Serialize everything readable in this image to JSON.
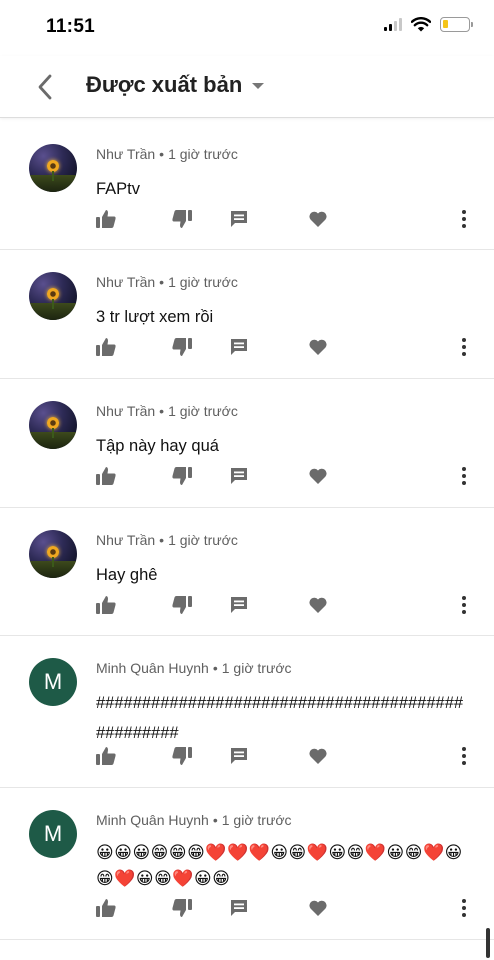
{
  "status_bar": {
    "time": "11:51"
  },
  "header": {
    "title": "Được xuất bản"
  },
  "comments": [
    {
      "avatar": "sunflower-photo",
      "author": "Như Trần",
      "time": "1 giờ trước",
      "text": "FAPtv"
    },
    {
      "avatar": "sunflower-photo",
      "author": "Như Trần",
      "time": "1 giờ trước",
      "text": "3 tr lượt xem rồi"
    },
    {
      "avatar": "sunflower-photo",
      "author": "Như Trần",
      "time": "1 giờ trước",
      "text": "Tập này hay quá"
    },
    {
      "avatar": "sunflower-photo",
      "author": "Như Trần",
      "time": "1 giờ trước",
      "text": "Hay ghê"
    },
    {
      "avatar_letter": "M",
      "author": "Minh Quân Huynh",
      "time": "1 giờ trước",
      "text": "#################################################"
    },
    {
      "avatar_letter": "M",
      "author": "Minh Quân Huynh",
      "time": "1 giờ trước",
      "text": "😀😀😀😁😁😁❤️❤️❤️😀😁❤️😀😁❤️😀😁❤️😀😁❤️😀😁❤️😀😁"
    }
  ],
  "icons": {
    "like": "thumbs-up-icon",
    "dislike": "thumbs-down-icon",
    "reply": "reply-icon",
    "heart": "heart-icon",
    "more": "more-vertical-icon"
  },
  "colors": {
    "avatar_letter_bg": "#1e5a47",
    "action_icon": "#6b6b6b",
    "battery_level": "#f5c518"
  }
}
